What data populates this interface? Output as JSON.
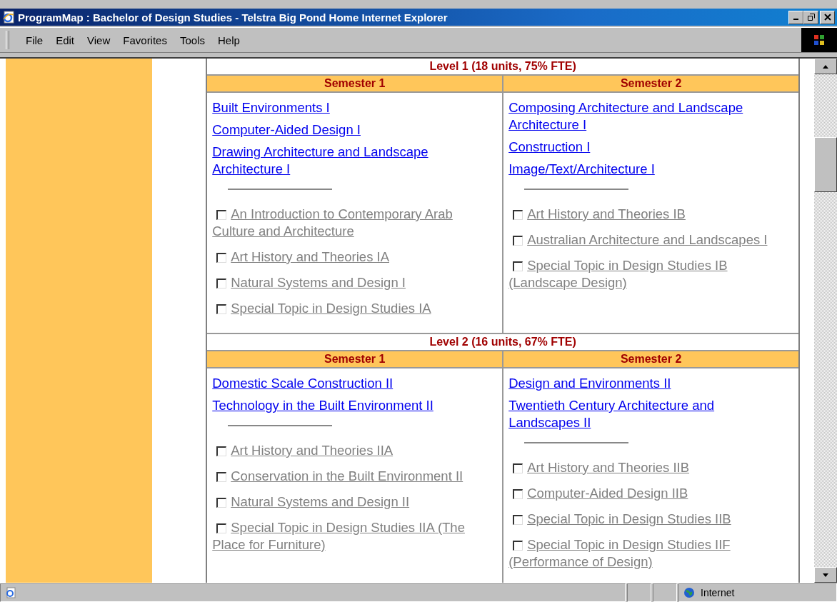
{
  "window": {
    "title": "ProgramMap : Bachelor of Design Studies - Telstra Big Pond Home Internet Explorer"
  },
  "menu": [
    {
      "label": "File"
    },
    {
      "label": "Edit"
    },
    {
      "label": "View"
    },
    {
      "label": "Favorites"
    },
    {
      "label": "Tools"
    },
    {
      "label": "Help"
    }
  ],
  "levels": [
    {
      "heading": "Level 1 (18 units, 75% FTE)",
      "semesters": [
        {
          "heading": "Semester 1",
          "core": [
            "Built Environments I",
            "Computer-Aided Design I",
            "Drawing Architecture and Landscape Architecture I"
          ],
          "electives": [
            {
              "label": "An Introduction to Contemporary Arab Culture and Architecture",
              "checked": false
            },
            {
              "label": "Art History and Theories IA",
              "checked": false
            },
            {
              "label": "Natural Systems and Design I",
              "checked": false
            },
            {
              "label": "Special Topic in Design Studies IA",
              "checked": false
            }
          ]
        },
        {
          "heading": "Semester 2",
          "core": [
            "Composing Architecture and Landscape Architecture I",
            "Construction I",
            "Image/Text/Architecture I"
          ],
          "electives": [
            {
              "label": "Art History and Theories IB",
              "checked": false
            },
            {
              "label": "Australian Architecture and Landscapes I",
              "checked": false
            },
            {
              "label": "Special Topic in Design Studies IB (Landscape Design)",
              "checked": false
            }
          ]
        }
      ]
    },
    {
      "heading": "Level 2 (16 units, 67% FTE)",
      "semesters": [
        {
          "heading": "Semester 1",
          "core": [
            "Domestic Scale Construction II",
            "Technology in the Built Environment II"
          ],
          "electives": [
            {
              "label": "Art History and Theories IIA",
              "checked": false
            },
            {
              "label": "Conservation in the Built Environment II",
              "checked": false
            },
            {
              "label": "Natural Systems and Design II",
              "checked": false
            },
            {
              "label": "Special Topic in Design Studies IIA (The Place for Furniture)",
              "checked": false
            }
          ]
        },
        {
          "heading": "Semester 2",
          "core": [
            "Design and Environments II",
            "Twentieth Century Architecture and Landscapes II"
          ],
          "electives": [
            {
              "label": "Art History and Theories IIB",
              "checked": false
            },
            {
              "label": "Computer-Aided Design IIB",
              "checked": false
            },
            {
              "label": "Special Topic in Design Studies IIB",
              "checked": false
            },
            {
              "label": "Special Topic in Design Studies IIF (Performance of Design)",
              "checked": false
            }
          ]
        }
      ]
    }
  ],
  "status_bar": {
    "zone": "Internet"
  }
}
